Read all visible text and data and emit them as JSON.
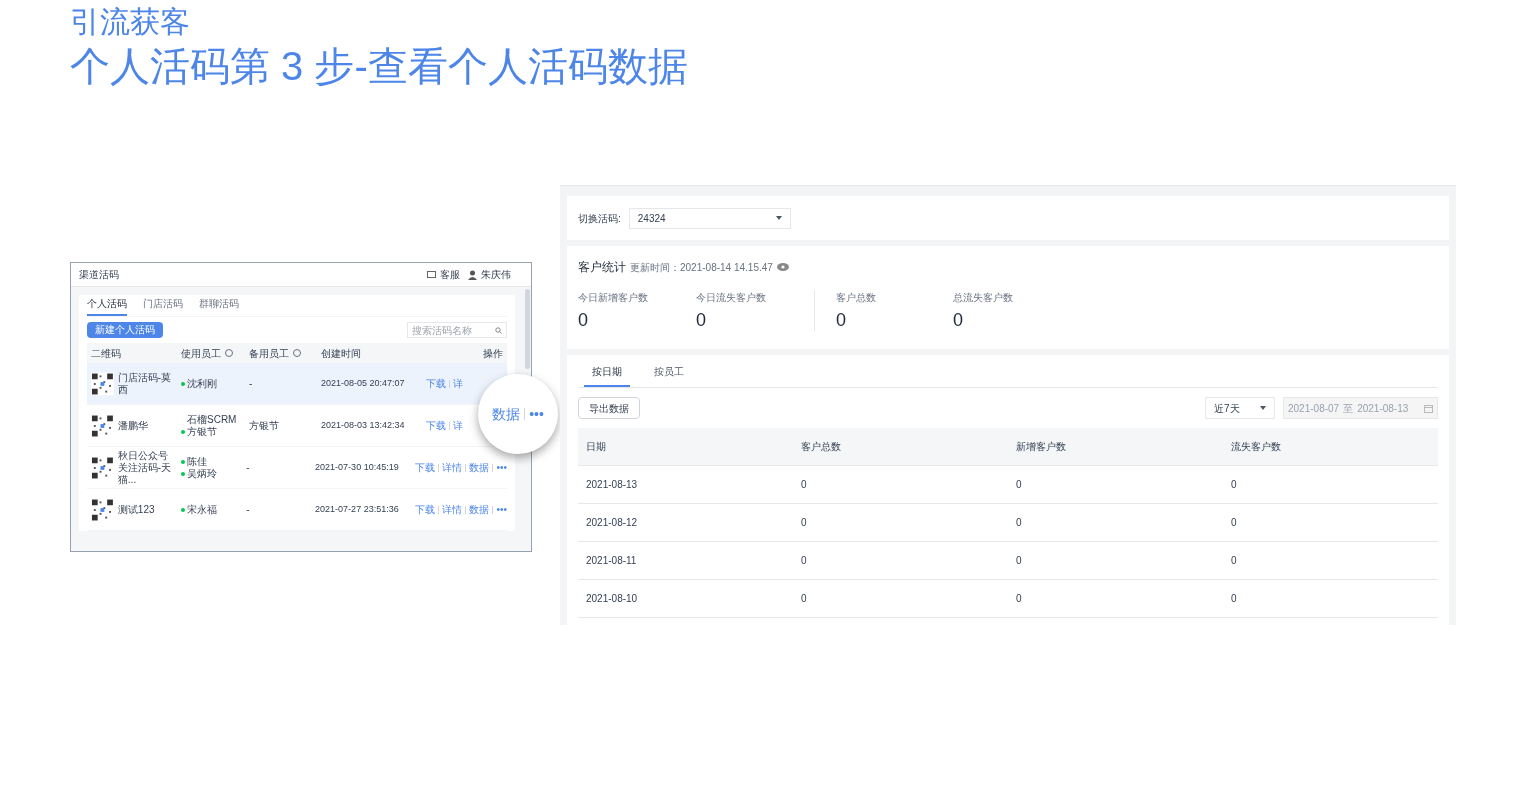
{
  "heading": {
    "section": "引流获客",
    "title": "个人活码第 3 步-查看个人活码数据"
  },
  "list_screen": {
    "title": "渠道活码",
    "service": "客服",
    "user": "朱庆伟",
    "tabs": [
      {
        "label": "个人活码",
        "selected": true
      },
      {
        "label": "门店活码",
        "selected": false
      },
      {
        "label": "群聊活码",
        "selected": false
      }
    ],
    "create_button": "新建个人活码",
    "search": {
      "placeholder": "搜索活码名称"
    },
    "columns": [
      "二维码",
      "使用员工",
      "备用员工",
      "创建时间",
      "操作"
    ],
    "rows": [
      {
        "name": "门店活码-莫西",
        "staff": [
          {
            "name": "沈利刚",
            "dot": true
          }
        ],
        "backup": "-",
        "created": "2021-08-05 20:47:07",
        "actions": [
          "下载",
          "详"
        ],
        "selected": true
      },
      {
        "name": "潘鹏华",
        "staff": [
          {
            "name": "石榴SCRM",
            "dot": false
          },
          {
            "name": "方银节",
            "dot": true
          }
        ],
        "backup": "方银节",
        "created": "2021-08-03 13:42:34",
        "actions": [
          "下载",
          "详"
        ],
        "selected": false
      },
      {
        "name": "秋日公众号关注活码-天猫...",
        "staff": [
          {
            "name": "陈佳",
            "dot": true
          },
          {
            "name": "吴炳玲",
            "dot": true
          }
        ],
        "backup": "-",
        "created": "2021-07-30 10:45:19",
        "actions": [
          "下载",
          "详情",
          "数据",
          "•••"
        ],
        "selected": false
      },
      {
        "name": "测试123",
        "staff": [
          {
            "name": "宋永福",
            "dot": true
          }
        ],
        "backup": "-",
        "created": "2021-07-27 23:51:36",
        "actions": [
          "下载",
          "详情",
          "数据",
          "•••"
        ],
        "selected": false
      }
    ],
    "magnifier": [
      "数据",
      "•••"
    ]
  },
  "data_screen": {
    "switch_label": "切换活码:",
    "switch_value": "24324",
    "stats_title": "客户统计",
    "updated": "更新时间：2021-08-14 14.15.47",
    "stats": [
      {
        "label": "今日新增客户数",
        "value": "0"
      },
      {
        "label": "今日流失客户数",
        "value": "0"
      },
      {
        "label": "客户总数",
        "value": "0"
      },
      {
        "label": "总流失客户数",
        "value": "0"
      }
    ],
    "tabs": [
      {
        "label": "按日期",
        "selected": true
      },
      {
        "label": "按员工",
        "selected": false
      }
    ],
    "export_button": "导出数据",
    "range_select": "近7天",
    "date_from": "2021-08-07",
    "date_sep": "至",
    "date_to": "2021-08-13",
    "columns": [
      "日期",
      "客户总数",
      "新增客户数",
      "流失客户数"
    ],
    "rows": [
      [
        "2021-08-13",
        "0",
        "0",
        "0"
      ],
      [
        "2021-08-12",
        "0",
        "0",
        "0"
      ],
      [
        "2021-08-11",
        "0",
        "0",
        "0"
      ],
      [
        "2021-08-10",
        "0",
        "0",
        "0"
      ]
    ]
  }
}
